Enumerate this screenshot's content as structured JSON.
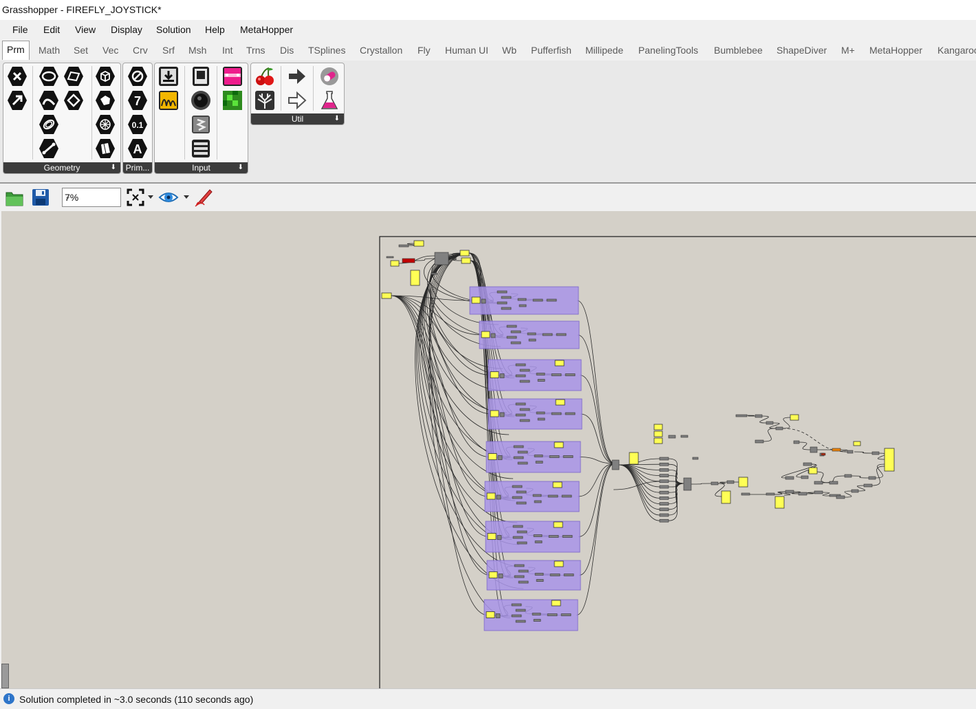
{
  "window": {
    "title": "Grasshopper - FIREFLY_JOYSTICK*"
  },
  "menu": [
    "File",
    "Edit",
    "View",
    "Display",
    "Solution",
    "Help",
    "MetaHopper"
  ],
  "tabs": [
    "Prm",
    "Math",
    "Set",
    "Vec",
    "Crv",
    "Srf",
    "Msh",
    "Int",
    "Trns",
    "Dis",
    "TSplines",
    "Crystallon",
    "Fly",
    "Human UI",
    "Wb",
    "Pufferfish",
    "Millipede",
    "PanelingTools",
    "Bumblebee",
    "ShapeDiver",
    "M+",
    "MetaHopper",
    "Kangaroo"
  ],
  "active_tab": "Prm",
  "ribbon": {
    "panels": [
      "Geometry",
      "Prim...",
      "Input",
      "Util"
    ],
    "icons": {
      "geometry": [
        "close-icon",
        "circle-param-icon",
        "surface-param-icon",
        "box-param-icon",
        "vector-param-icon",
        "curve-param-icon",
        "point-param-icon",
        "brep-param-icon",
        "line-param-icon",
        "mesh-param-icon",
        "field-param-icon",
        "geometry-param-icon",
        "twisted-box-icon"
      ],
      "primitive": [
        "no-entry-icon",
        "integer-param-icon",
        "number-param-icon",
        "text-param-icon"
      ],
      "input": [
        "import-icon",
        "slider-icon",
        "gradient-icon",
        "graph-mapper-icon",
        "button-icon",
        "swatch-icon",
        "value-list-icon",
        "panel-icon"
      ],
      "util": [
        "cherry-icon",
        "tree-icon",
        "jump-right-icon",
        "jump-outline-icon",
        "capsule-icon",
        "flask-icon"
      ]
    }
  },
  "canvas_toolbar": {
    "zoom": "7%",
    "icons": [
      "open-file-icon",
      "save-file-icon",
      "zoom-extents-icon",
      "preview-eye-icon",
      "sketch-pen-icon"
    ]
  },
  "colors": {
    "canvas": "#d4d0c8",
    "group": "#a894e8",
    "panel": "#ffff55",
    "component": "#808080",
    "error": "#c00000",
    "warning": "#e8820c"
  },
  "status": {
    "message": "Solution completed in ~3.0 seconds (110 seconds ago)"
  }
}
